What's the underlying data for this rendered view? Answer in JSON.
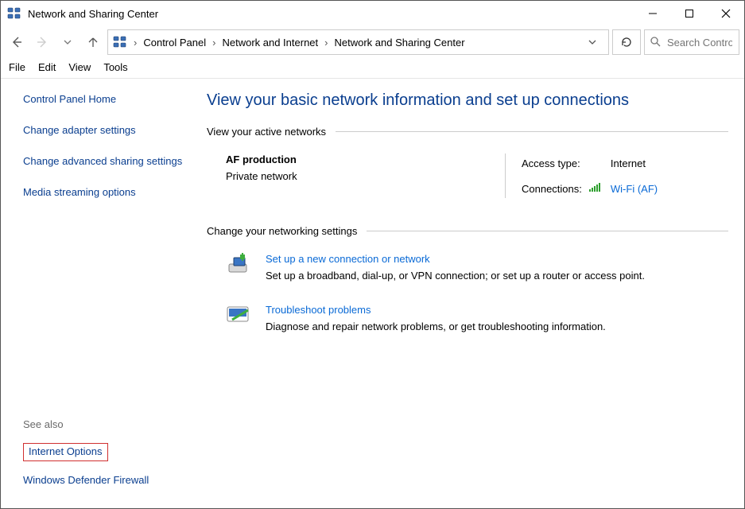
{
  "window": {
    "title": "Network and Sharing Center"
  },
  "breadcrumb": {
    "items": [
      "Control Panel",
      "Network and Internet",
      "Network and Sharing Center"
    ]
  },
  "search": {
    "placeholder": "Search Control Panel"
  },
  "menu": {
    "items": [
      "File",
      "Edit",
      "View",
      "Tools"
    ]
  },
  "sidebar": {
    "home": "Control Panel Home",
    "links": [
      "Change adapter settings",
      "Change advanced sharing settings",
      "Media streaming options"
    ],
    "see_also_header": "See also",
    "see_also": [
      "Internet Options",
      "Windows Defender Firewall"
    ]
  },
  "main": {
    "heading": "View your basic network information and set up connections",
    "active_header": "View your active networks",
    "network": {
      "name": "AF production",
      "type": "Private network",
      "access_label": "Access type:",
      "access_value": "Internet",
      "conn_label": "Connections:",
      "conn_value": "Wi-Fi (AF)"
    },
    "change_header": "Change your networking settings",
    "settings": [
      {
        "title": "Set up a new connection or network",
        "desc": "Set up a broadband, dial-up, or VPN connection; or set up a router or access point."
      },
      {
        "title": "Troubleshoot problems",
        "desc": "Diagnose and repair network problems, or get troubleshooting information."
      }
    ]
  }
}
